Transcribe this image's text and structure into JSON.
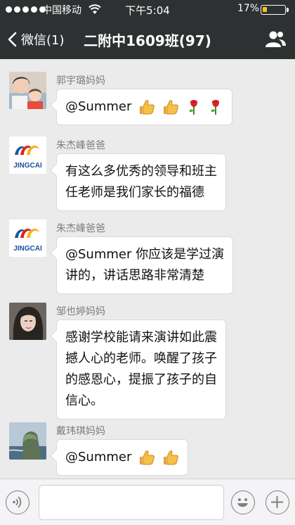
{
  "status_bar": {
    "carrier": "中国移动",
    "time": "下午5:04",
    "battery_percent": "17%",
    "battery_level": 0.17,
    "signal_bars": 5,
    "battery_color": "#f5c518"
  },
  "nav": {
    "back_label": "微信(1)",
    "title": "二附中1609班(97)",
    "back_icon": "chevron-left-icon",
    "contacts_icon": "group-contacts-icon"
  },
  "messages": [
    {
      "sender": "郭宇璐妈妈",
      "text": "@Summer",
      "emojis": [
        "thumbs-up",
        "thumbs-up",
        "rose",
        "rose"
      ],
      "avatar": "photo-mother-child"
    },
    {
      "sender": "朱杰峰爸爸",
      "lines": [
        "有这么多优秀的领导和班主",
        "任老师是我们家长的福德"
      ],
      "avatar": "jingcai-logo",
      "avatar_text": "JINGCAI"
    },
    {
      "sender": "朱杰峰爸爸",
      "lines": [
        "@Summer 你应该是学过演",
        "讲的，讲话思路非常清楚"
      ],
      "avatar": "jingcai-logo",
      "avatar_text": "JINGCAI"
    },
    {
      "sender": "邹也婷妈妈",
      "lines": [
        "感谢学校能请来演讲如此震",
        "撼人心的老师。唤醒了孩子",
        "的感恩心，提振了孩子的自",
        "信心。"
      ],
      "avatar": "photo-woman-portrait"
    },
    {
      "sender": "戴玮琪妈妈",
      "text": "@Summer",
      "emojis": [
        "thumbs-up",
        "thumbs-up"
      ],
      "avatar": "photo-coastal-cliff"
    }
  ],
  "input_bar": {
    "voice_icon": "voice-icon",
    "emoji_icon": "emoji-icon",
    "plus_icon": "plus-icon",
    "input_value": ""
  },
  "colors": {
    "nav_background": "#2e3132",
    "chat_background": "#ebebeb",
    "bubble_background": "#ffffff",
    "sender_name": "#7d7d7d"
  }
}
